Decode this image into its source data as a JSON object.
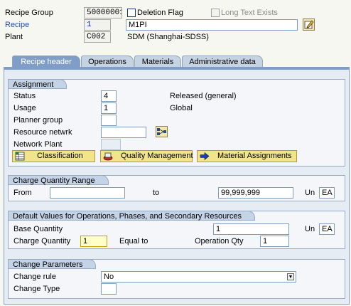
{
  "header": {
    "recipe_group_label": "Recipe Group",
    "recipe_group_value": "50000001",
    "deletion_flag_label": "Deletion Flag",
    "long_text_label": "Long Text Exists",
    "recipe_label": "Recipe",
    "recipe_value": "1",
    "recipe_desc": "M1PI",
    "plant_label": "Plant",
    "plant_value": "C002",
    "plant_desc": "SDM (Shanghai-SDSS)"
  },
  "tabs": [
    {
      "label": "Recipe header"
    },
    {
      "label": "Operations"
    },
    {
      "label": "Materials"
    },
    {
      "label": "Administrative data"
    }
  ],
  "assignment": {
    "title": "Assignment",
    "status_label": "Status",
    "status_value": "4",
    "status_text": "Released (general)",
    "usage_label": "Usage",
    "usage_value": "1",
    "usage_text": "Global",
    "planner_group_label": "Planner group",
    "resource_network_label": "Resource netwrk",
    "network_plant_label": "Network Plant",
    "buttons": {
      "classification": "Classification",
      "quality_management": "Quality Management",
      "material_assignments": "Material Assignments"
    }
  },
  "charge_qty_range": {
    "title": "Charge Quantity Range",
    "from_label": "From",
    "to_label": "to",
    "to_value": "99,999,999",
    "un_label": "Un",
    "un_value": "EA"
  },
  "default_values": {
    "title": "Default Values for Operations, Phases, and Secondary Resources",
    "base_qty_label": "Base Quantity",
    "base_qty_value": "1",
    "un_label": "Un",
    "un_value": "EA",
    "charge_qty_label": "Charge Quantity",
    "charge_qty_value": "1",
    "equal_to_label": "Equal to",
    "operation_qty_label": "Operation Qty",
    "operation_qty_value": "1"
  },
  "change_params": {
    "title": "Change Parameters",
    "change_rule_label": "Change rule",
    "change_rule_value": "No",
    "change_type_label": "Change Type"
  }
}
